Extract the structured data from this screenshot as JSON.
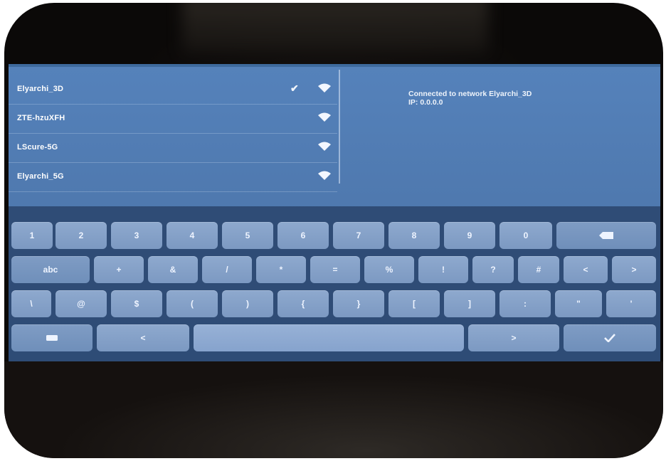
{
  "networks": [
    {
      "name": "Elyarchi_3D",
      "connected": true
    },
    {
      "name": "ZTE-hzuXFH",
      "connected": false
    },
    {
      "name": "LScure-5G",
      "connected": false
    },
    {
      "name": "Elyarchi_5G",
      "connected": false
    }
  ],
  "status": {
    "line1": "Connected to network Elyarchi_3D",
    "line2": "IP: 0.0.0.0"
  },
  "keyboard": {
    "row1": [
      "1",
      "2",
      "3",
      "4",
      "5",
      "6",
      "7",
      "8",
      "9",
      "0"
    ],
    "row2": [
      "abc",
      "+",
      "&",
      "/",
      "*",
      "=",
      "%",
      "!",
      "?",
      "#",
      "<",
      ">"
    ],
    "row3": [
      "\\",
      "@",
      "$",
      "(",
      ")",
      "{",
      "}",
      "[",
      "]",
      ":",
      "\"",
      "'"
    ],
    "icons": {
      "backspace": "backspace-icon",
      "enter": "checkmark-icon",
      "keyboard": "keyboard-icon",
      "left": "left-arrow-icon",
      "right": "right-arrow-icon"
    },
    "arrow_left_label": "<",
    "arrow_right_label": ">"
  },
  "colors": {
    "screen": "#5582bb",
    "key": "#8ea9ce",
    "keyboard_bg": "#2d4a73"
  }
}
